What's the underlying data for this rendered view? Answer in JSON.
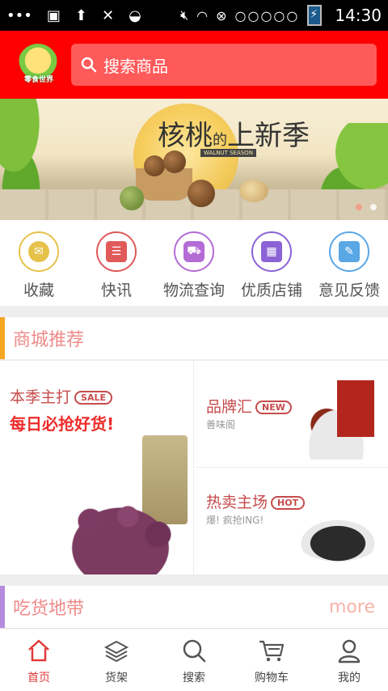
{
  "status_bar": {
    "time": "14:30",
    "signal_dots": "○○○○○"
  },
  "search": {
    "placeholder": "搜索商品"
  },
  "logo": {
    "text": "零食世界"
  },
  "banner": {
    "title_a": "核桃",
    "title_small": "的",
    "title_b": "上新季",
    "subtitle": "WALNUT SEASON"
  },
  "shortcuts": [
    {
      "label": "收藏",
      "color": "#e6c24a",
      "icon": "envelope-icon"
    },
    {
      "label": "快讯",
      "color": "#e05a5a",
      "icon": "clipboard-icon"
    },
    {
      "label": "物流查询",
      "color": "#b46bd6",
      "icon": "car-icon"
    },
    {
      "label": "优质店铺",
      "color": "#8b63d6",
      "icon": "store-icon"
    },
    {
      "label": "意见反馈",
      "color": "#5aa7e6",
      "icon": "edit-icon"
    }
  ],
  "sections": {
    "mall": {
      "title": "商城推荐",
      "bar_color": "#f5a623"
    },
    "foodie": {
      "title": "吃货地带",
      "more": "more",
      "bar_color": "#b58be0"
    }
  },
  "promos": {
    "season": {
      "title": "本季主打",
      "tag": "SALE",
      "headline": "每日必抢好货!"
    },
    "brand": {
      "title": "品牌汇",
      "tag": "NEW",
      "subtitle": "善味阁"
    },
    "hot": {
      "title": "热卖主场",
      "tag": "HOT",
      "subtitle": "爆! 疯抢ING!"
    }
  },
  "bottom_nav": [
    {
      "label": "首页",
      "icon": "home-icon",
      "active": true
    },
    {
      "label": "货架",
      "icon": "layers-icon",
      "active": false
    },
    {
      "label": "搜索",
      "icon": "search-icon",
      "active": false
    },
    {
      "label": "购物车",
      "icon": "cart-icon",
      "active": false
    },
    {
      "label": "我的",
      "icon": "user-icon",
      "active": false
    }
  ],
  "colors": {
    "header_red": "#ff0000",
    "search_bg": "#ff5a5a",
    "active_nav": "#e23a3a"
  }
}
